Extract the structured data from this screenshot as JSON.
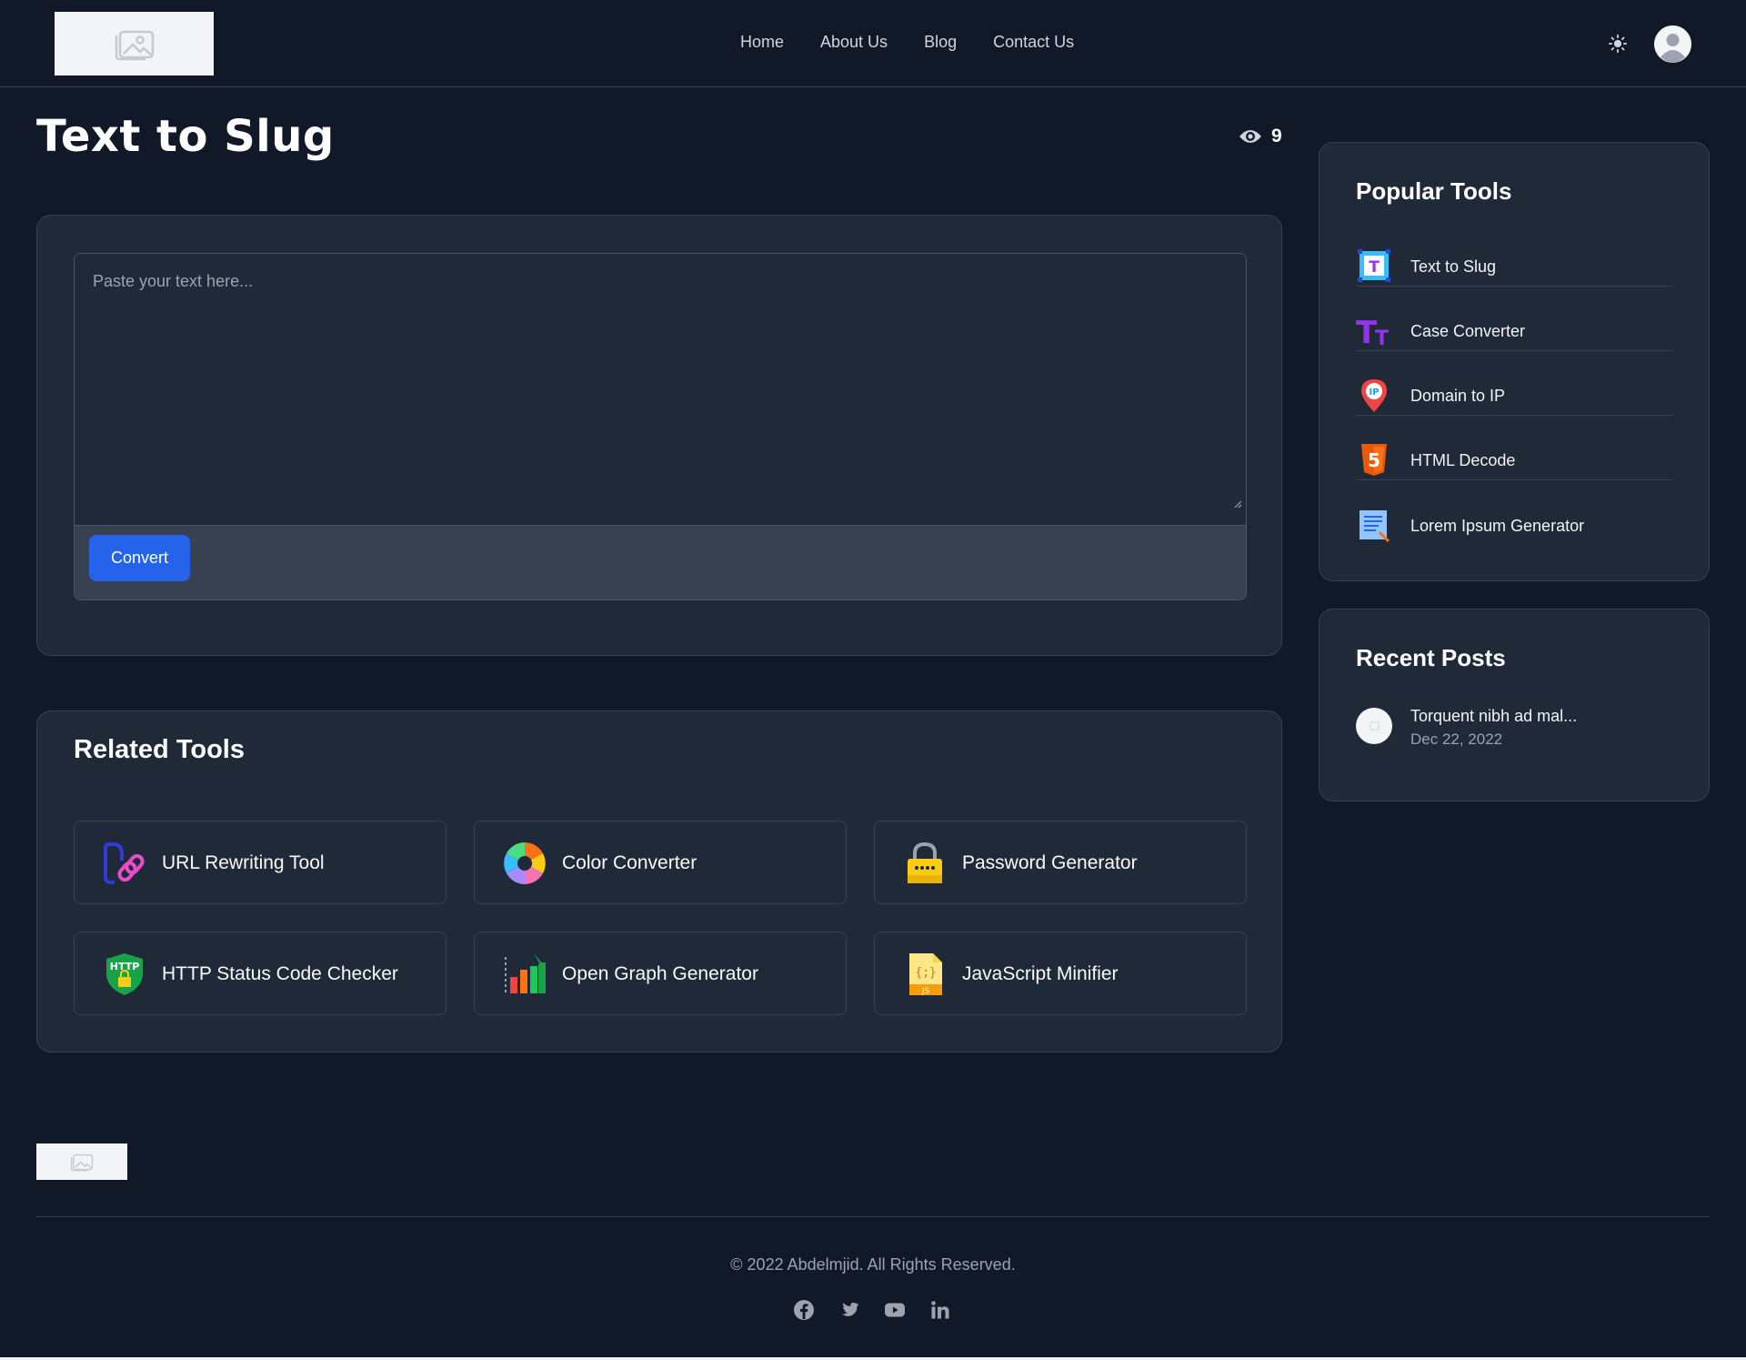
{
  "header": {
    "nav": [
      "Home",
      "About Us",
      "Blog",
      "Contact Us"
    ]
  },
  "page": {
    "title": "Text to Slug",
    "views": "9"
  },
  "tool": {
    "placeholder": "Paste your text here...",
    "value": "",
    "convert_label": "Convert",
    "accent": "#2563eb"
  },
  "related": {
    "heading": "Related Tools",
    "items": [
      {
        "label": "URL Rewriting Tool",
        "icon": "link-icon"
      },
      {
        "label": "Color Converter",
        "icon": "color-wheel-icon"
      },
      {
        "label": "Password Generator",
        "icon": "padlock-icon"
      },
      {
        "label": "HTTP Status Code Checker",
        "icon": "http-shield-icon"
      },
      {
        "label": "Open Graph Generator",
        "icon": "bar-chart-icon"
      },
      {
        "label": "JavaScript Minifier",
        "icon": "js-file-icon"
      }
    ]
  },
  "sidebar": {
    "popular_heading": "Popular Tools",
    "popular": [
      {
        "label": "Text to Slug",
        "icon": "text-t-icon"
      },
      {
        "label": "Case Converter",
        "icon": "case-tt-icon"
      },
      {
        "label": "Domain to IP",
        "icon": "ip-pin-icon"
      },
      {
        "label": "HTML Decode",
        "icon": "html5-icon"
      },
      {
        "label": "Lorem Ipsum Generator",
        "icon": "document-icon"
      }
    ],
    "recent_heading": "Recent Posts",
    "recent": [
      {
        "title": "Torquent nibh ad mal...",
        "date": "Dec 22, 2022"
      }
    ]
  },
  "footer": {
    "copyright": "© 2022 Abdelmjid. All Rights Reserved.",
    "socials": [
      "facebook-icon",
      "twitter-icon",
      "youtube-icon",
      "linkedin-icon"
    ]
  }
}
